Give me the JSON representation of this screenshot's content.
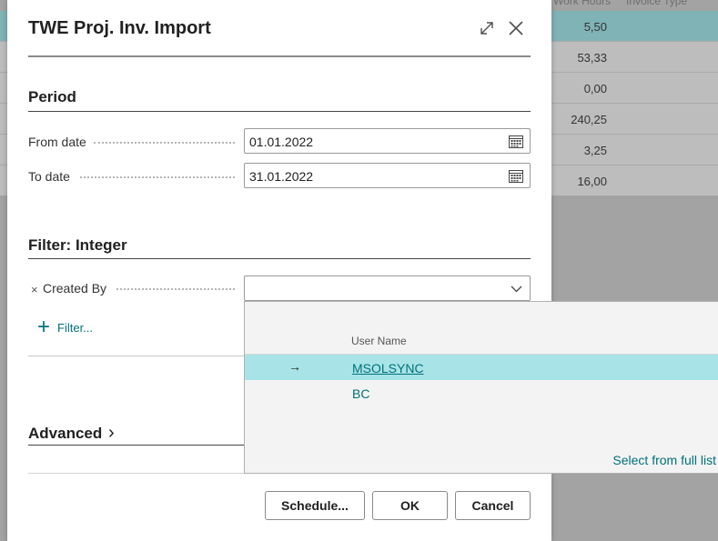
{
  "background": {
    "header": {
      "col1": "Work Hours",
      "col2": "Invoice Type"
    },
    "rows": [
      "5,50",
      "53,33",
      "0,00",
      "240,25",
      "3,25",
      "16,00"
    ],
    "selected_row_index": 0
  },
  "dialog": {
    "title": "TWE Proj. Inv. Import",
    "expand_icon": "expand-icon",
    "close_icon": "close-icon",
    "period": {
      "title": "Period",
      "from_label": "From date",
      "from_value": "01.01.2022",
      "to_label": "To date",
      "to_value": "31.01.2022"
    },
    "filter": {
      "title": "Filter: Integer",
      "remove_symbol": "×",
      "created_by_label": "Created By",
      "created_by_value": "",
      "add_filter_symbol": "+",
      "add_filter_label": "Filter..."
    },
    "advanced": {
      "title": "Advanced",
      "chevron": "›"
    },
    "buttons": {
      "schedule": "Schedule...",
      "ok": "OK",
      "cancel": "Cancel"
    }
  },
  "popup": {
    "column_header": "User Name",
    "rows": [
      {
        "arrow": "→",
        "name": "MSOLSYNC",
        "selected": true
      },
      {
        "arrow": "",
        "name": "BC",
        "selected": false
      }
    ],
    "footer_link": "Select from full list"
  },
  "colors": {
    "accent": "#00707a",
    "selected_row": "#a8e4e7",
    "background_selected": "#7fb3b6"
  }
}
